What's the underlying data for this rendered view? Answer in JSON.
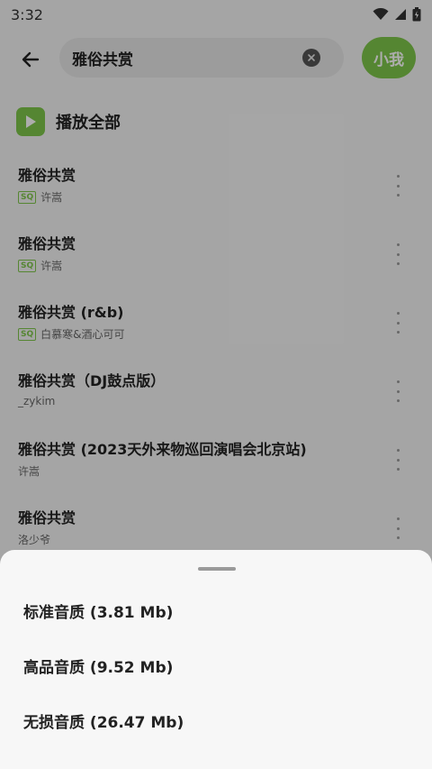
{
  "status_bar": {
    "time": "3:32"
  },
  "header": {
    "search_value": "雅俗共赏",
    "avatar_label": "小我"
  },
  "play_all": {
    "label": "播放全部"
  },
  "songs": [
    {
      "title": "雅俗共赏",
      "artist": "许嵩",
      "badge": "SQ"
    },
    {
      "title": "雅俗共赏",
      "artist": "许嵩",
      "badge": "SQ"
    },
    {
      "title": "雅俗共赏 (r&b)",
      "artist": "白慕寒&酒心可可",
      "badge": "SQ"
    },
    {
      "title": "雅俗共赏（DJ鼓点版）",
      "artist": "_zykim",
      "badge": ""
    },
    {
      "title": "雅俗共赏 (2023天外来物巡回演唱会北京站)",
      "artist": "许嵩",
      "badge": ""
    },
    {
      "title": "雅俗共赏",
      "artist": "洛少爷",
      "badge": ""
    }
  ],
  "sheet": {
    "options": [
      {
        "label": "标准音质 (3.81 Mb)"
      },
      {
        "label": "高品音质 (9.52 Mb)"
      },
      {
        "label": "无损音质 (26.47 Mb)"
      }
    ]
  },
  "colors": {
    "accent": "#7ec64a"
  }
}
